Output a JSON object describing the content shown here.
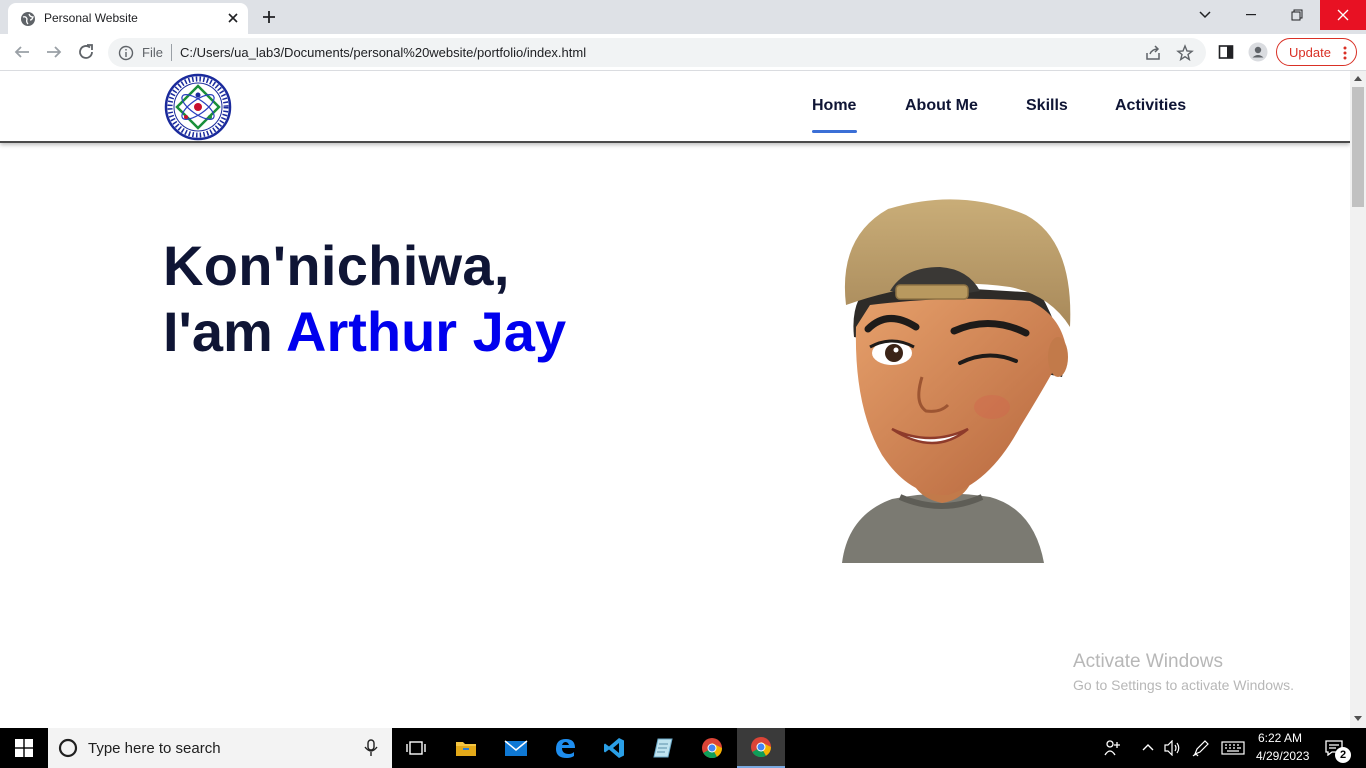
{
  "browser": {
    "tab_title": "Personal Website",
    "address_scheme": "File",
    "url": "C:/Users/ua_lab3/Documents/personal%20website/portfolio/index.html",
    "update_label": "Update"
  },
  "site": {
    "nav": [
      {
        "label": "Home",
        "active": true
      },
      {
        "label": "About Me",
        "active": false
      },
      {
        "label": "Skills",
        "active": false
      },
      {
        "label": "Activities",
        "active": false
      }
    ],
    "hero": {
      "line1": "Kon'nichiwa,",
      "line2_prefix": "I'am",
      "line2_name": "Arthur Jay"
    },
    "colors": {
      "heading": "#0f1535",
      "name_accent": "#0000ee",
      "nav_underline": "#3b6fd6"
    }
  },
  "watermark": {
    "title": "Activate Windows",
    "subtitle": "Go to Settings to activate Windows."
  },
  "taskbar": {
    "search_placeholder": "Type here to search",
    "time": "6:22 AM",
    "date": "4/29/2023",
    "notification_count": "2"
  }
}
